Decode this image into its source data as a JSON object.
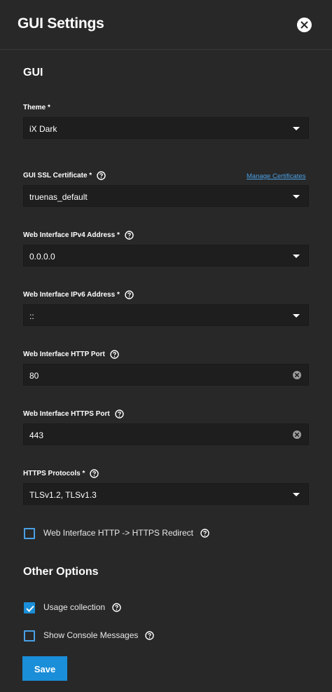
{
  "header": {
    "title": "GUI Settings"
  },
  "sections": {
    "gui_title": "GUI",
    "other_title": "Other Options"
  },
  "fields": {
    "theme": {
      "label": "Theme *",
      "value": "iX Dark"
    },
    "ssl_cert": {
      "label": "GUI SSL Certificate *",
      "value": "truenas_default",
      "link": "Manage Certificates"
    },
    "ipv4": {
      "label": "Web Interface IPv4 Address *",
      "value": "0.0.0.0"
    },
    "ipv6": {
      "label": "Web Interface IPv6 Address *",
      "value": "::"
    },
    "http_port": {
      "label": "Web Interface HTTP Port",
      "value": "80"
    },
    "https_port": {
      "label": "Web Interface HTTPS Port",
      "value": "443"
    },
    "https_protocols": {
      "label": "HTTPS Protocols *",
      "value": "TLSv1.2, TLSv1.3"
    }
  },
  "checkboxes": {
    "redirect": {
      "label": "Web Interface HTTP -> HTTPS Redirect",
      "checked": false
    },
    "usage": {
      "label": "Usage collection",
      "checked": true
    },
    "console": {
      "label": "Show Console Messages",
      "checked": false
    }
  },
  "actions": {
    "save_label": "Save"
  },
  "colors": {
    "background": "#282828",
    "input_bg": "#1e1e1e",
    "accent": "#1a8ed8",
    "link": "#4aa0e6"
  },
  "icons": {
    "close": "close-icon",
    "help": "help-circle-icon",
    "clear": "clear-circle-icon",
    "caret": "chevron-down-icon",
    "check": "checkmark-icon"
  }
}
